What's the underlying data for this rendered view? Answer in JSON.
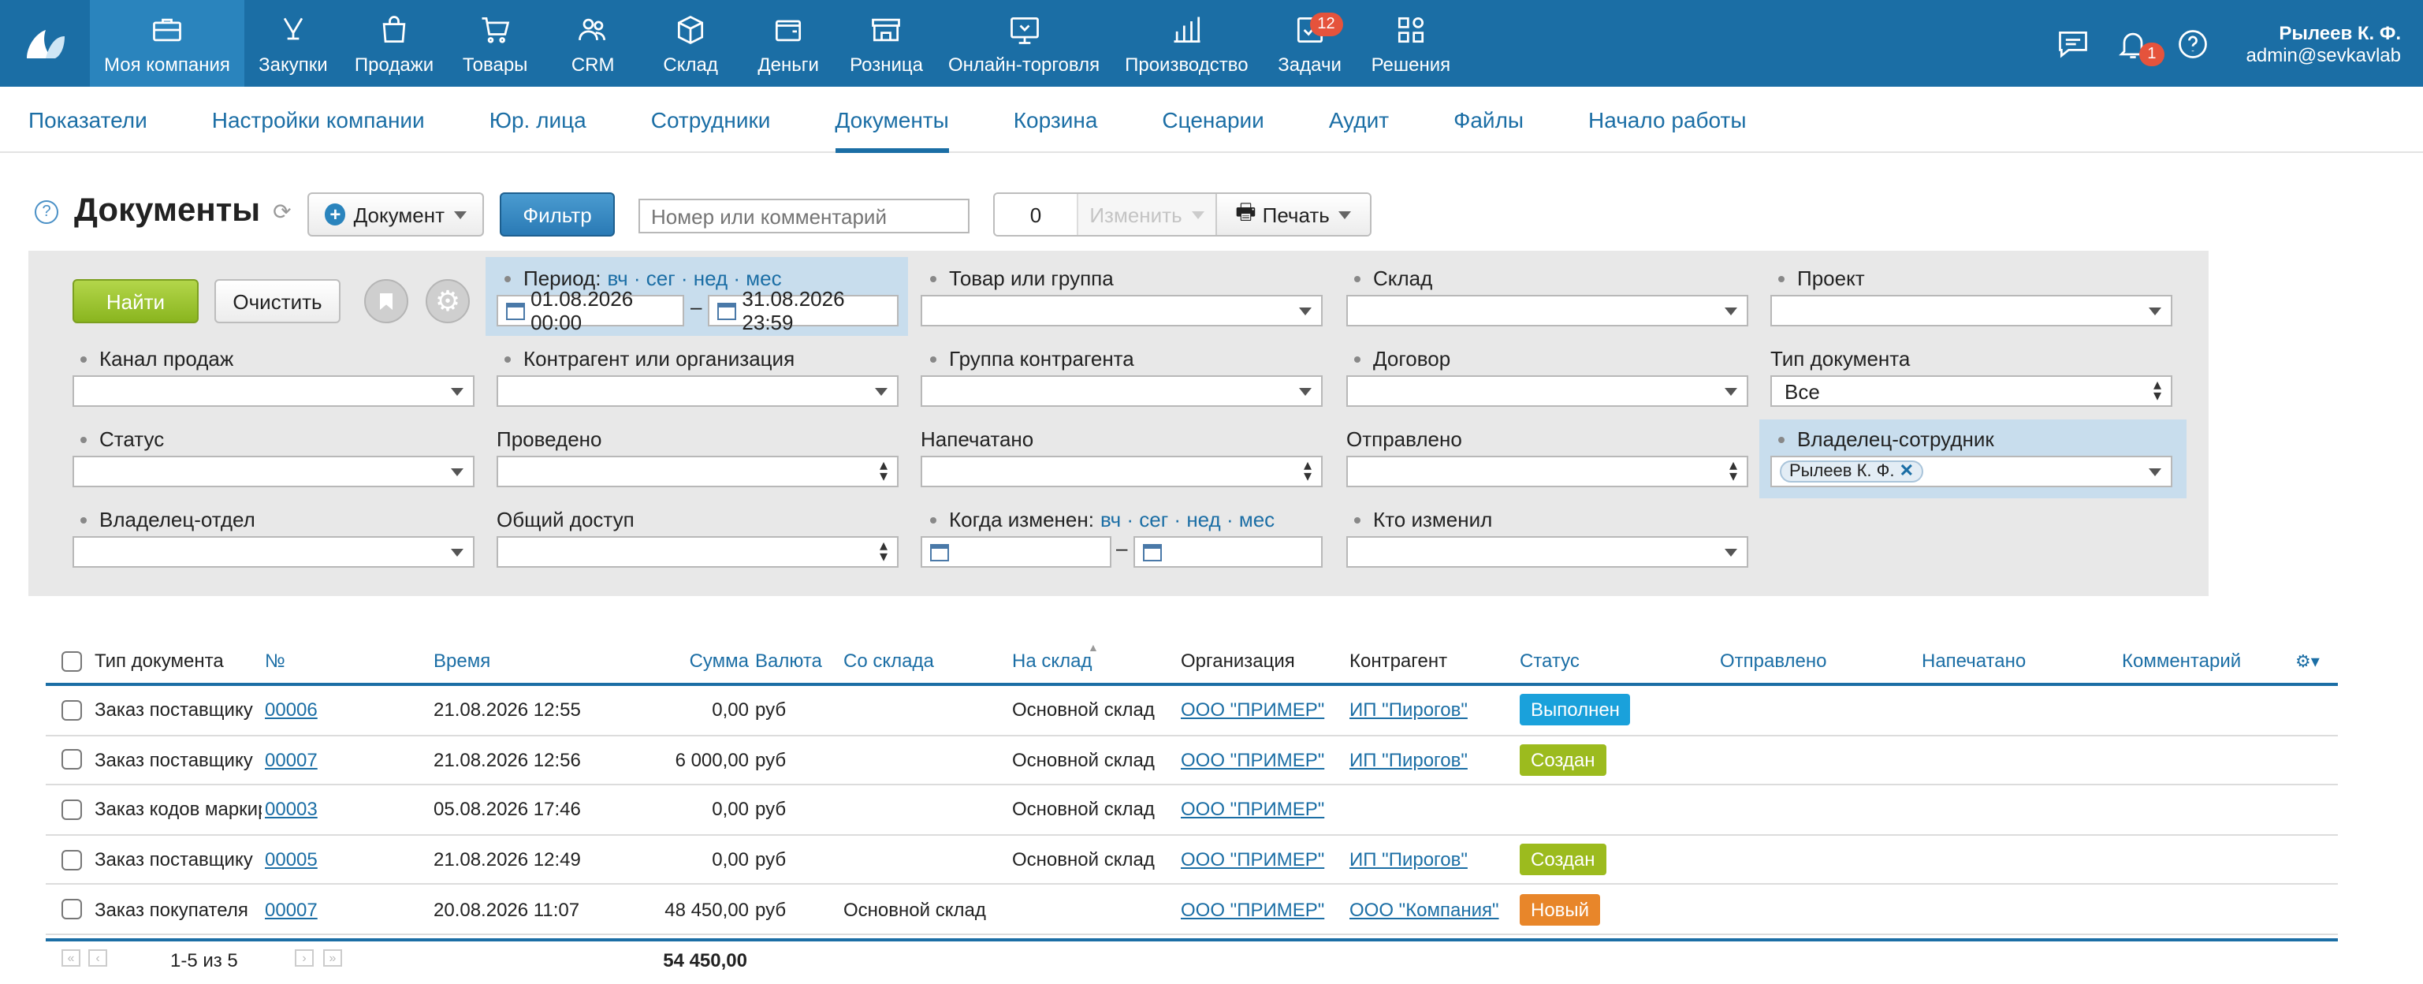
{
  "nav": {
    "items": [
      {
        "label": "Моя компания",
        "icon": "briefcase-icon"
      },
      {
        "label": "Закупки",
        "icon": "purchase-icon"
      },
      {
        "label": "Продажи",
        "icon": "bag-icon"
      },
      {
        "label": "Товары",
        "icon": "cart-icon"
      },
      {
        "label": "CRM",
        "icon": "people-icon"
      },
      {
        "label": "Склад",
        "icon": "box-icon"
      },
      {
        "label": "Деньги",
        "icon": "wallet-icon"
      },
      {
        "label": "Розница",
        "icon": "store-icon"
      },
      {
        "label": "Онлайн-торговля",
        "icon": "online-icon"
      },
      {
        "label": "Производство",
        "icon": "chart-bars-icon"
      },
      {
        "label": "Задачи",
        "icon": "tasks-icon",
        "badge": "12"
      },
      {
        "label": "Решения",
        "icon": "apps-icon"
      }
    ],
    "notifications_badge": "1",
    "user_name": "Рылеев К. Ф.",
    "user_email": "admin@sevkavlab"
  },
  "subnav": [
    "Показатели",
    "Настройки компании",
    "Юр. лица",
    "Сотрудники",
    "Документы",
    "Корзина",
    "Сценарии",
    "Аудит",
    "Файлы",
    "Начало работы"
  ],
  "page": {
    "help": "?",
    "title": "Документы",
    "document_button": "Документ",
    "filter_button": "Фильтр",
    "search_placeholder": "Номер или комментарий",
    "selected_count": "0",
    "change_button": "Изменить",
    "print_button": "Печать"
  },
  "filters": {
    "find": "Найти",
    "clear": "Очистить",
    "period_label": "Период:",
    "period_links": "вч · сег · нед · мес",
    "period_from": "01.08.2026 00:00",
    "period_to": "31.08.2026 23:59",
    "product": "Товар или группа",
    "warehouse": "Склад",
    "project": "Проект",
    "sales_channel": "Канал продаж",
    "counterparty": "Контрагент или организация",
    "counterparty_group": "Группа контрагента",
    "contract": "Договор",
    "doc_type_label": "Тип документа",
    "doc_type_value": "Все",
    "status": "Статус",
    "posted": "Проведено",
    "printed": "Напечатано",
    "sent": "Отправлено",
    "owner_employee": "Владелец-сотрудник",
    "owner_employee_tag": "Рылеев К. Ф.",
    "owner_dept": "Владелец-отдел",
    "shared": "Общий доступ",
    "changed_label": "Когда изменен:",
    "changed_links": "вч · сег · нед · мес",
    "changed_by": "Кто изменил",
    "dash": "–"
  },
  "table": {
    "headers": [
      "Тип документа",
      "№",
      "Время",
      "Сумма",
      "Валюта",
      "Со склада",
      "На склад",
      "Организация",
      "Контрагент",
      "Статус",
      "Отправлено",
      "Напечатано",
      "Комментарий"
    ],
    "rows": [
      {
        "type": "Заказ поставщику",
        "num": "00006",
        "time": "21.08.2026 12:55",
        "sum": "0,00",
        "cur": "руб",
        "from": "",
        "to": "Основной склад",
        "org": "ООО \"ПРИМЕР\"",
        "cp": "ИП \"Пирогов\"",
        "status": "Выполнен",
        "status_color": "#1aa1db"
      },
      {
        "type": "Заказ поставщику",
        "num": "00007",
        "time": "21.08.2026 12:56",
        "sum": "6 000,00",
        "cur": "руб",
        "from": "",
        "to": "Основной склад",
        "org": "ООО \"ПРИМЕР\"",
        "cp": "ИП \"Пирогов\"",
        "status": "Создан",
        "status_color": "#9cbb1e"
      },
      {
        "type": "Заказ кодов маркир",
        "num": "00003",
        "time": "05.08.2026 17:46",
        "sum": "0,00",
        "cur": "руб",
        "from": "",
        "to": "Основной склад",
        "org": "ООО \"ПРИМЕР\"",
        "cp": "",
        "status": "",
        "status_color": ""
      },
      {
        "type": "Заказ поставщику",
        "num": "00005",
        "time": "21.08.2026 12:49",
        "sum": "0,00",
        "cur": "руб",
        "from": "",
        "to": "Основной склад",
        "org": "ООО \"ПРИМЕР\"",
        "cp": "ИП \"Пирогов\"",
        "status": "Создан",
        "status_color": "#9cbb1e"
      },
      {
        "type": "Заказ покупателя",
        "num": "00007",
        "time": "20.08.2026 11:07",
        "sum": "48 450,00",
        "cur": "руб",
        "from": "Основной склад",
        "to": "",
        "org": "ООО \"ПРИМЕР\"",
        "cp": "ООО \"Компания\"",
        "status": "Новый",
        "status_color": "#e8862a"
      }
    ],
    "pager": "1-5 из 5",
    "total": "54 450,00"
  }
}
